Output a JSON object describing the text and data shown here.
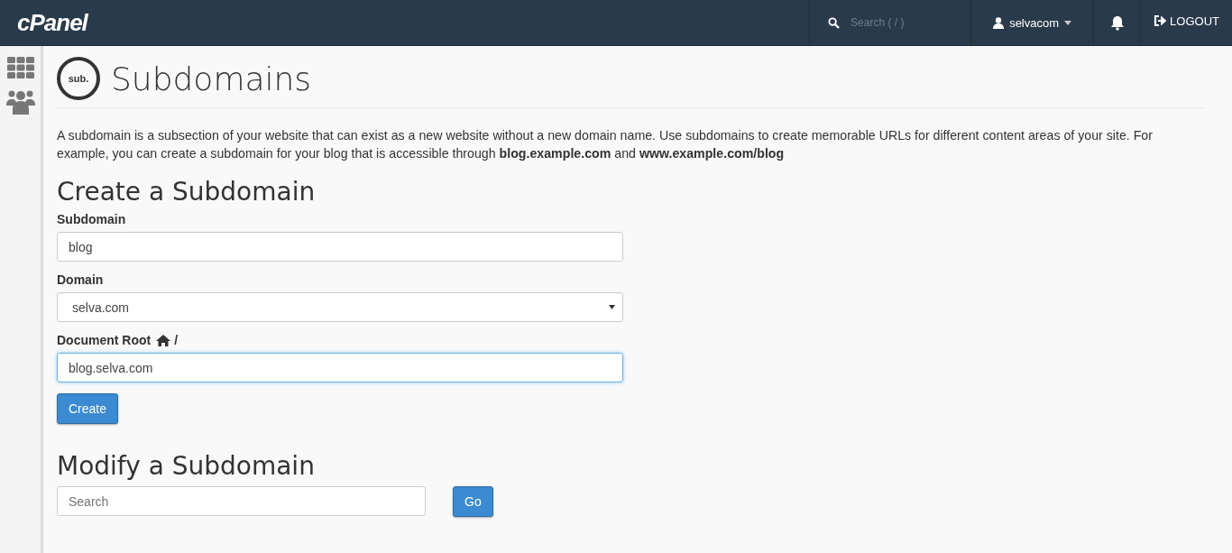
{
  "header": {
    "logo": "cPanel",
    "search": {
      "placeholder": "Search ( / )"
    },
    "user": "selvacom",
    "logout": "LOGOUT"
  },
  "page": {
    "title": "Subdomains",
    "badge": "sub.",
    "description": "A subdomain is a subsection of your website that can exist as a new website without a new domain name. Use subdomains to create memorable URLs for different content areas of your site. For example, you can create a subdomain for your blog that is accessible through **blog.example.com** and **www.example.com/blog**"
  },
  "create": {
    "heading": "Create a Subdomain",
    "fields": [
      {
        "kind": "text",
        "label": "Subdomain",
        "value": "blog",
        "focused": false
      },
      {
        "kind": "select",
        "label": "Domain",
        "value": "selva.com",
        "focused": false
      },
      {
        "kind": "text",
        "label": "Document Root",
        "home_prefix": "/",
        "value": "blog.selva.com",
        "focused": true
      }
    ],
    "button": "Create"
  },
  "modify": {
    "heading": "Modify a Subdomain",
    "search": {
      "placeholder": "Search"
    },
    "button": "Go"
  }
}
